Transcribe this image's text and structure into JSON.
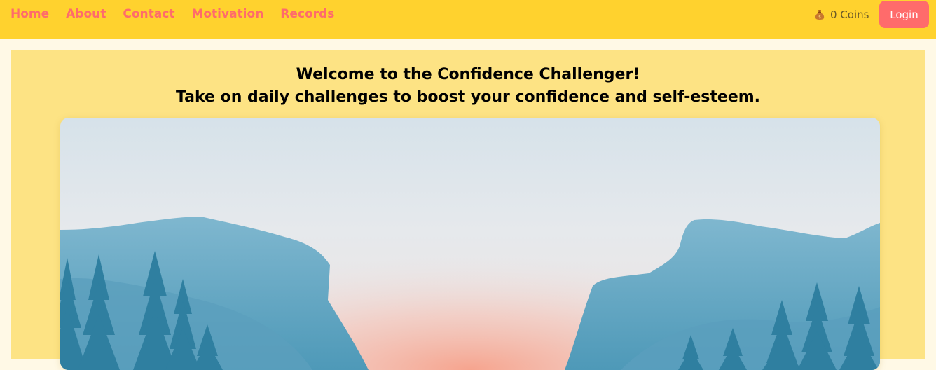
{
  "nav": {
    "links": [
      {
        "label": "Home"
      },
      {
        "label": "About"
      },
      {
        "label": "Contact"
      },
      {
        "label": "Motivation"
      },
      {
        "label": "Records"
      }
    ],
    "coins": {
      "icon": "money-bag-icon",
      "label": "0 Coins"
    },
    "login_label": "Login"
  },
  "hero": {
    "title_line1": "Welcome to the Confidence Challenger!",
    "title_line2": "Take on daily challenges to boost your confidence and self-esteem."
  },
  "colors": {
    "navbar": "#ffd22e",
    "nav_link": "#ff6b6b",
    "login_button": "#ff6b6b",
    "hero_background": "#fde384",
    "page_background": "#fff9e6"
  }
}
